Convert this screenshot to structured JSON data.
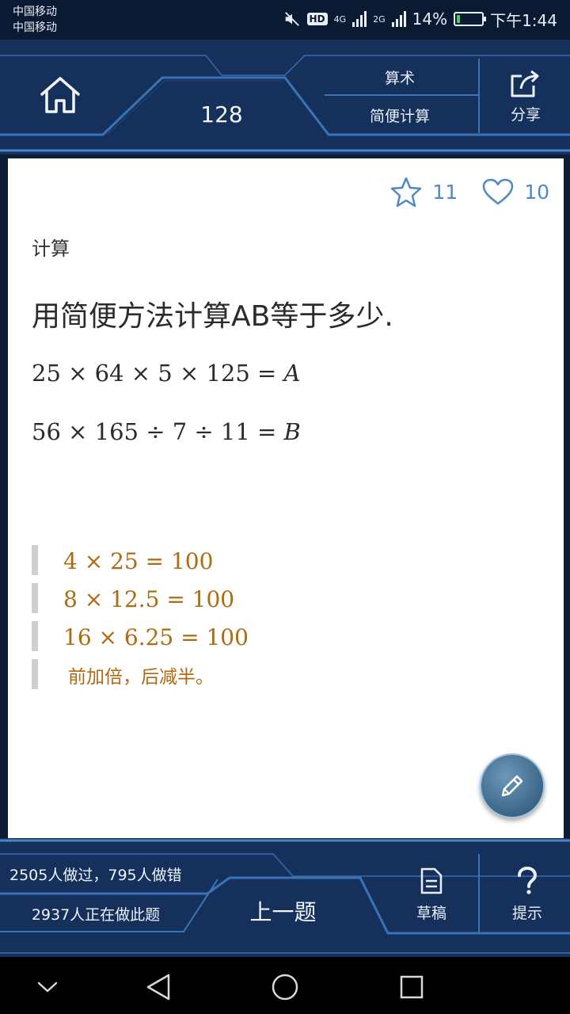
{
  "status_bar": {
    "carrier_1": "中国移动",
    "carrier_2": "中国移动",
    "hd": "HD",
    "net_4g": "4G",
    "net_2g": "2G",
    "battery": "14%",
    "battery_level": 0.14,
    "time": "下午1:44"
  },
  "header": {
    "count": "128",
    "subject": "算术",
    "topic": "简便计算",
    "share_label": "分享"
  },
  "card": {
    "favorites": "11",
    "likes": "10",
    "category": "计算",
    "question": "用简便方法计算AB等于多少.",
    "formula_a": {
      "text": "25 × 64 × 5 × 125 = ",
      "var": "A"
    },
    "formula_b": {
      "text": "56 × 165 ÷ 7 ÷ 11 = ",
      "var": "B"
    },
    "hints": [
      "4 × 25 = 100",
      "8 × 12.5 = 100",
      "16 × 6.25 = 100",
      "前加倍，后减半。"
    ]
  },
  "bottom": {
    "done_text": "2505人做过，795人做错",
    "doing_text": "2937人正在做此题",
    "prev_label": "上一题",
    "draft_label": "草稿",
    "hint_label": "提示"
  },
  "colors": {
    "background": "#0d1d38",
    "accent": "#4f88c6",
    "hint_text": "#b06a10"
  },
  "icons": [
    "home-icon",
    "share-icon",
    "star-icon",
    "heart-icon",
    "pencil-icon",
    "document-icon",
    "question-icon",
    "back-icon",
    "home-circle-icon",
    "recents-icon",
    "chevron-down-icon"
  ]
}
